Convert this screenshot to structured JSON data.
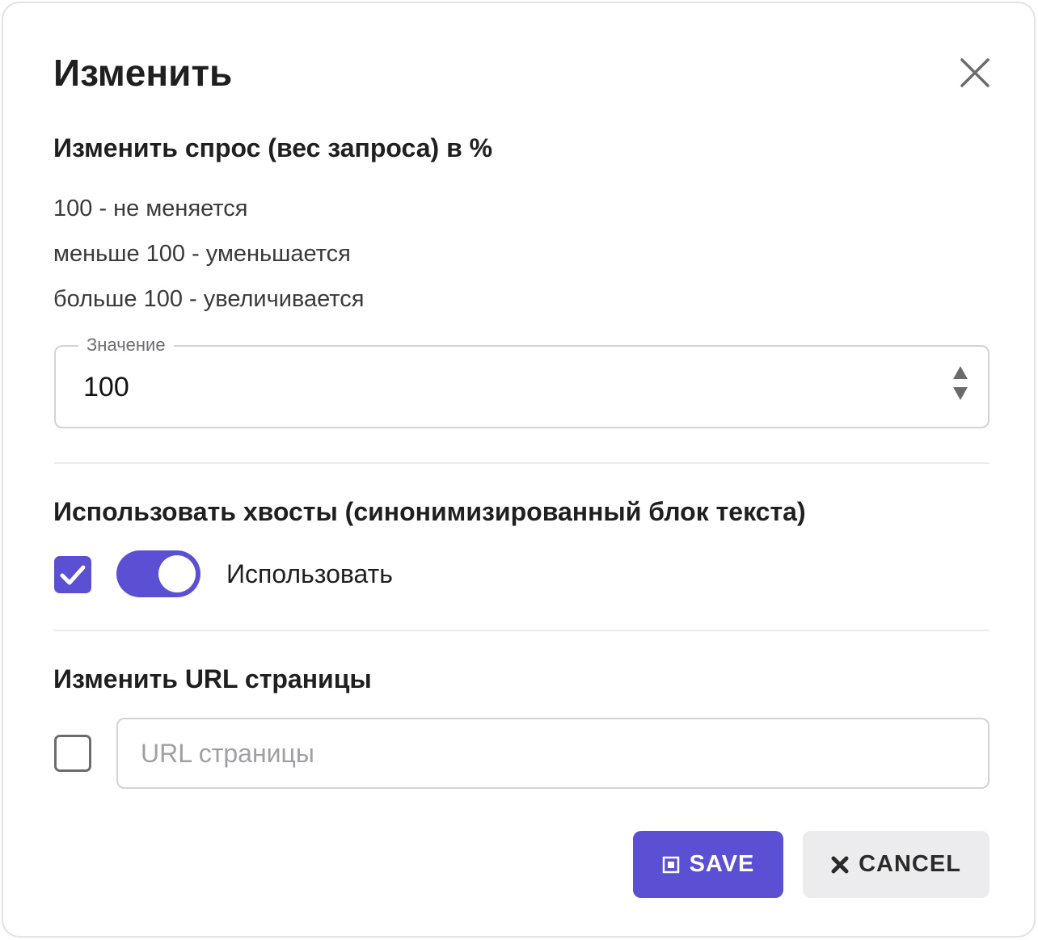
{
  "dialog": {
    "title": "Изменить"
  },
  "demand": {
    "heading": "Изменить спрос (вес запроса) в %",
    "lines": [
      "100 - не меняется",
      "меньше 100 - уменьшается",
      "больше 100 - увеличивается"
    ],
    "field_label": "Значение",
    "field_value": "100"
  },
  "tails": {
    "heading": "Использовать хвосты (синонимизированный блок текста)",
    "checkbox_checked": true,
    "toggle_on": true,
    "toggle_label": "Использовать"
  },
  "url": {
    "heading": "Изменить URL страницы",
    "checkbox_checked": false,
    "value": "",
    "placeholder": "URL страницы"
  },
  "actions": {
    "save_label": "SAVE",
    "cancel_label": "CANCEL"
  },
  "colors": {
    "accent": "#5b4fd4",
    "cancel_bg": "#ececee",
    "border": "#d3d3d6"
  },
  "icons": {
    "close": "close-icon",
    "spinner": "spinner-arrows-icon",
    "check": "checkmark-icon",
    "save": "save-icon",
    "cancel": "x-icon"
  }
}
